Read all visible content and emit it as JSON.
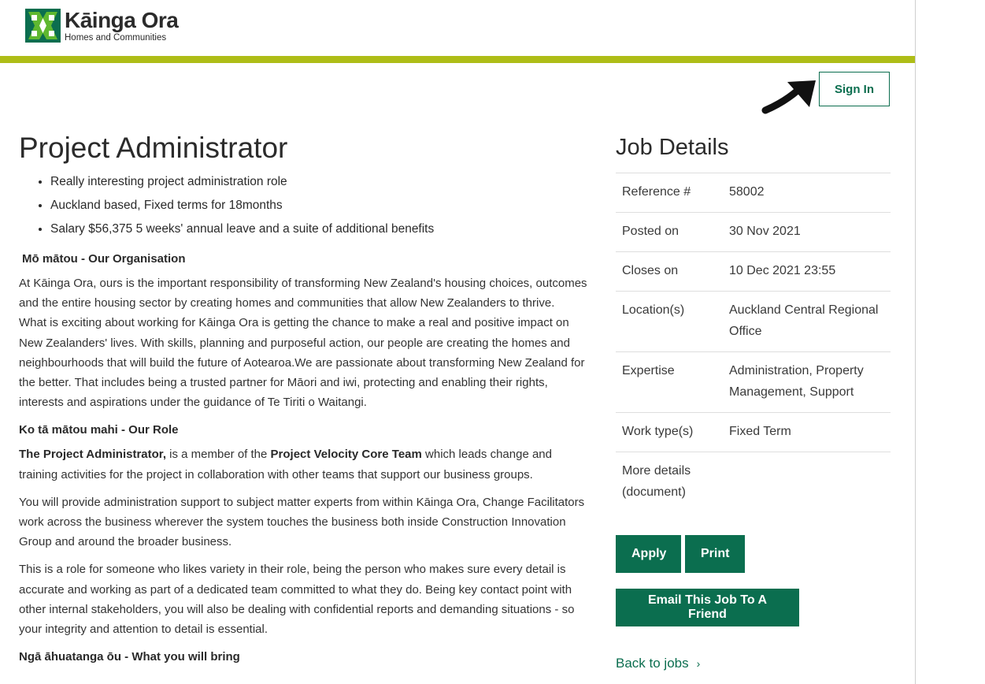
{
  "colors": {
    "brand_green": "#0b6e4f",
    "accent_lime": "#aebd17",
    "logo_light_green": "#5fb830"
  },
  "header": {
    "logo_title": "Kāinga Ora",
    "logo_subtitle": "Homes and Communities",
    "sign_in_label": "Sign In"
  },
  "job": {
    "title": "Project Administrator",
    "bullets": [
      "Really interesting project administration role",
      "Auckland based, Fixed terms for 18months",
      "Salary $56,375  5 weeks' annual leave and a suite of additional benefits"
    ],
    "org_heading": "Mō mātou - Our Organisation",
    "org_p1": "At Kāinga Ora, ours is the important responsibility of transforming New Zealand's housing choices, outcomes and the entire housing sector by creating homes and communities that allow New Zealanders to thrive.",
    "org_p2": "What is exciting about working for Kāinga Ora is getting the chance to make a real and positive impact on New Zealanders' lives. With skills, planning and purposeful action, our people are creating the homes and neighbourhoods that will build the future of Aotearoa.We are passionate about transforming New Zealand for the better. That includes being a trusted partner for Māori and iwi, protecting and enabling their rights, interests and aspirations under the guidance of Te Tiriti o Waitangi.",
    "role_heading": "Ko tā mātou mahi - Our Role",
    "role_p1_bold1": "The Project Administrator,",
    "role_p1_text1": " is a member of the ",
    "role_p1_bold2": "Project Velocity Core Team",
    "role_p1_text2": " which leads change and training activities for the project in collaboration with other teams that support our business groups.",
    "role_p2": "You will provide administration support to subject matter experts from within Kāinga Ora, Change Facilitators work across the business wherever the system touches the business both inside Construction Innovation Group and around the broader business.",
    "role_p3": "This is a role for someone who likes variety in their role, being the person who makes sure every detail is accurate and working as part of a dedicated team committed to what they do. Being key contact point with other internal stakeholders, you will also be dealing with confidential reports and demanding situations - so your integrity and attention to detail is essential.",
    "next_heading": "Ngā āhuatanga ōu - What you will bring"
  },
  "details": {
    "title": "Job Details",
    "rows": [
      {
        "key": "Reference #",
        "value": "58002"
      },
      {
        "key": "Posted on",
        "value": "30 Nov 2021"
      },
      {
        "key": "Closes on",
        "value": "10 Dec 2021 23:55"
      },
      {
        "key": "Location(s)",
        "value": "Auckland Central Regional Office"
      },
      {
        "key": "Expertise",
        "value": "Administration, Property Management, Support"
      },
      {
        "key": "Work type(s)",
        "value": "Fixed Term"
      },
      {
        "key": "More details (document)",
        "value": ""
      }
    ],
    "apply_label": "Apply",
    "print_label": "Print",
    "email_label": "Email This Job To A Friend",
    "back_label": "Back to jobs",
    "back_chevron": "›"
  }
}
